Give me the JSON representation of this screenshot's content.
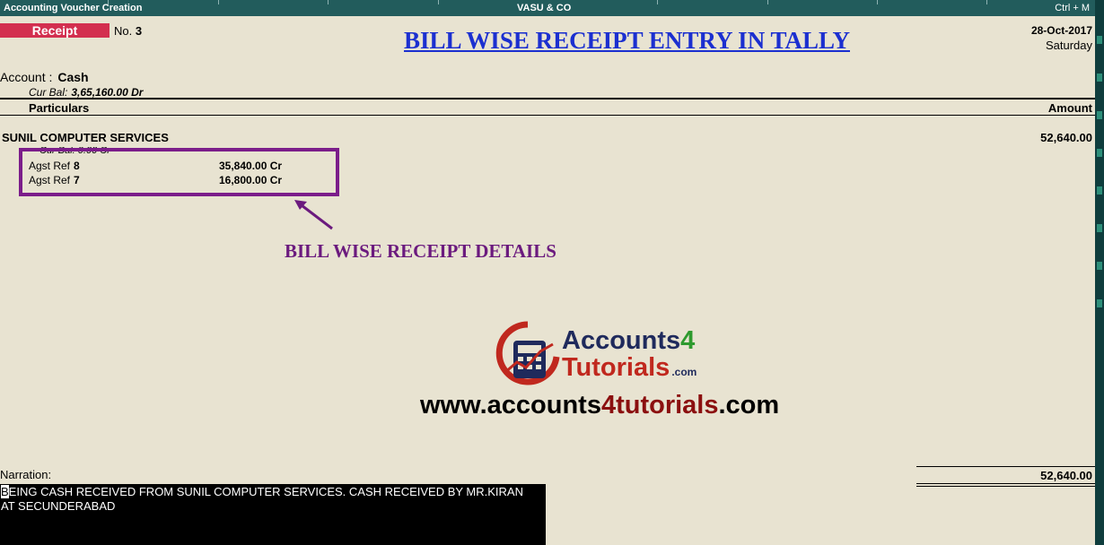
{
  "titlebar": {
    "left": "Accounting Voucher  Creation",
    "center": "VASU & CO",
    "right": "Ctrl + M"
  },
  "voucher": {
    "type": "Receipt",
    "no_label": "No.",
    "no_value": "3",
    "date": "28-Oct-2017",
    "day": "Saturday"
  },
  "heading": "BILL WISE RECEIPT ENTRY IN TALLY",
  "account": {
    "label": "Account :",
    "value": "Cash",
    "curbal_label": "Cur Bal:",
    "curbal_value": "3,65,160.00 Dr"
  },
  "columns": {
    "particulars": "Particulars",
    "amount": "Amount"
  },
  "entry": {
    "party": "SUNIL COMPUTER SERVICES",
    "amount": "52,640.00",
    "curbal": "Cur Bal:   0.00 Cr",
    "refs": [
      {
        "label": "Agst Ref",
        "ref": "8",
        "amount": "35,840.00  Cr"
      },
      {
        "label": "Agst Ref",
        "ref": "7",
        "amount": "16,800.00  Cr"
      }
    ]
  },
  "annotation": "BILL WISE RECEIPT DETAILS",
  "branding": {
    "logo_line1": "Accounts",
    "logo_line1_num": "4",
    "logo_line2": "Tutorials",
    "logo_line2_suffix": ".com",
    "website_a": "www.accounts",
    "website_b": "4tutorials",
    "website_c": ".com"
  },
  "narration": {
    "label": "Narration:",
    "first_char": "B",
    "text_rest": "EING CASH RECEIVED FROM SUNIL COMPUTER SERVICES. CASH RECEIVED BY MR.KIRAN",
    "text_line2": "AT SECUNDERABAD"
  },
  "total": "52,640.00",
  "colors": {
    "titlebar": "#225c5c",
    "receipt_badge": "#d32f4f",
    "heading": "#1b2fd0",
    "annotation": "#6b1a7e",
    "background": "#e8e3d1"
  }
}
